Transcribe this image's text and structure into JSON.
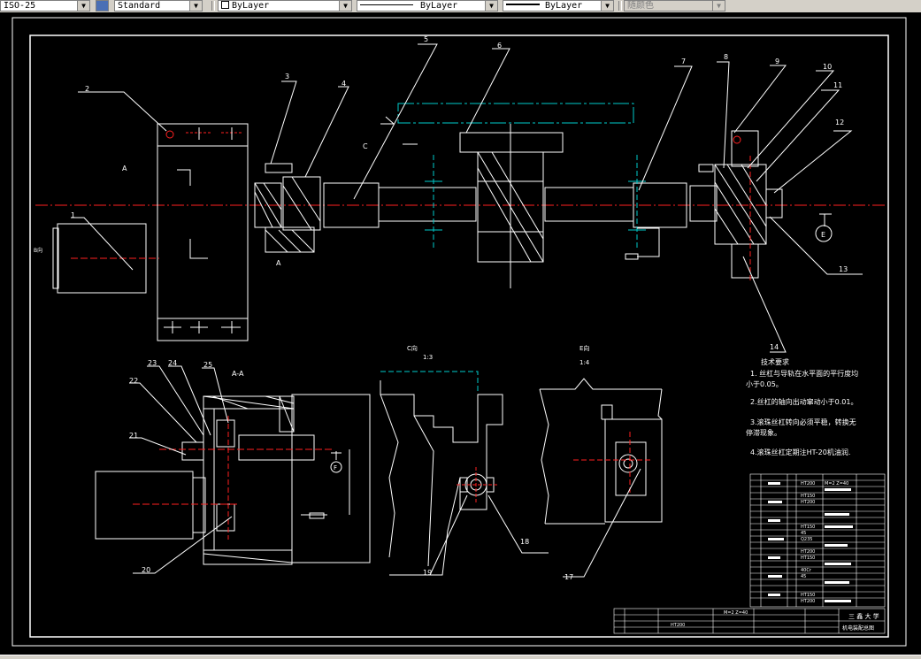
{
  "toolbar": {
    "dimstyle": "ISO-25",
    "textstyle": "Standard",
    "layer": "ByLayer",
    "linetype": "ByLayer",
    "lineweight": "ByLayer",
    "plotstyle": "随颜色"
  },
  "drawing": {
    "balloons": [
      "1",
      "2",
      "3",
      "4",
      "5",
      "6",
      "7",
      "8",
      "9",
      "10",
      "11",
      "12",
      "13",
      "14",
      "17",
      "18",
      "19",
      "20",
      "21",
      "22",
      "23",
      "24",
      "25"
    ],
    "view_labels": {
      "a": "A",
      "a_bottom": "A",
      "aa": "A-A",
      "b": "B向",
      "c": "C",
      "c_view": "C向",
      "c_scale": "1:3",
      "e_view": "E向",
      "e_scale": "1:4",
      "e_marker": "E",
      "f_marker": "F"
    },
    "requirements": {
      "title": "技术要求",
      "items": [
        "1. 丝杠与导轨在水平面的平行度均",
        "小于0.05。",
        "2.丝杠的轴向出动窜动小于0.01。",
        "3.滚珠丝杠转向必须平稳，转换无",
        "停滞现象。",
        "4.滚珠丝杠定期注HT-20机油润."
      ]
    },
    "title_block": {
      "school": "三 鑫 大 学",
      "drawing_name": "机电装配总图",
      "material": "HT200",
      "spec": "M=2 Z=40"
    },
    "bom_codes": [
      "HT200",
      "M=2 Z=40",
      "HT150",
      "HT200",
      "HT150",
      "45",
      "Q235",
      "HT200",
      "HT150",
      "40Cr",
      "45",
      "HT150",
      "HT200"
    ]
  },
  "colors": {
    "background": "#000000",
    "lines": "#ffffff",
    "centerline": "#ff2020",
    "hidden": "#00cccc",
    "toolbar": "#d4d0c8"
  }
}
